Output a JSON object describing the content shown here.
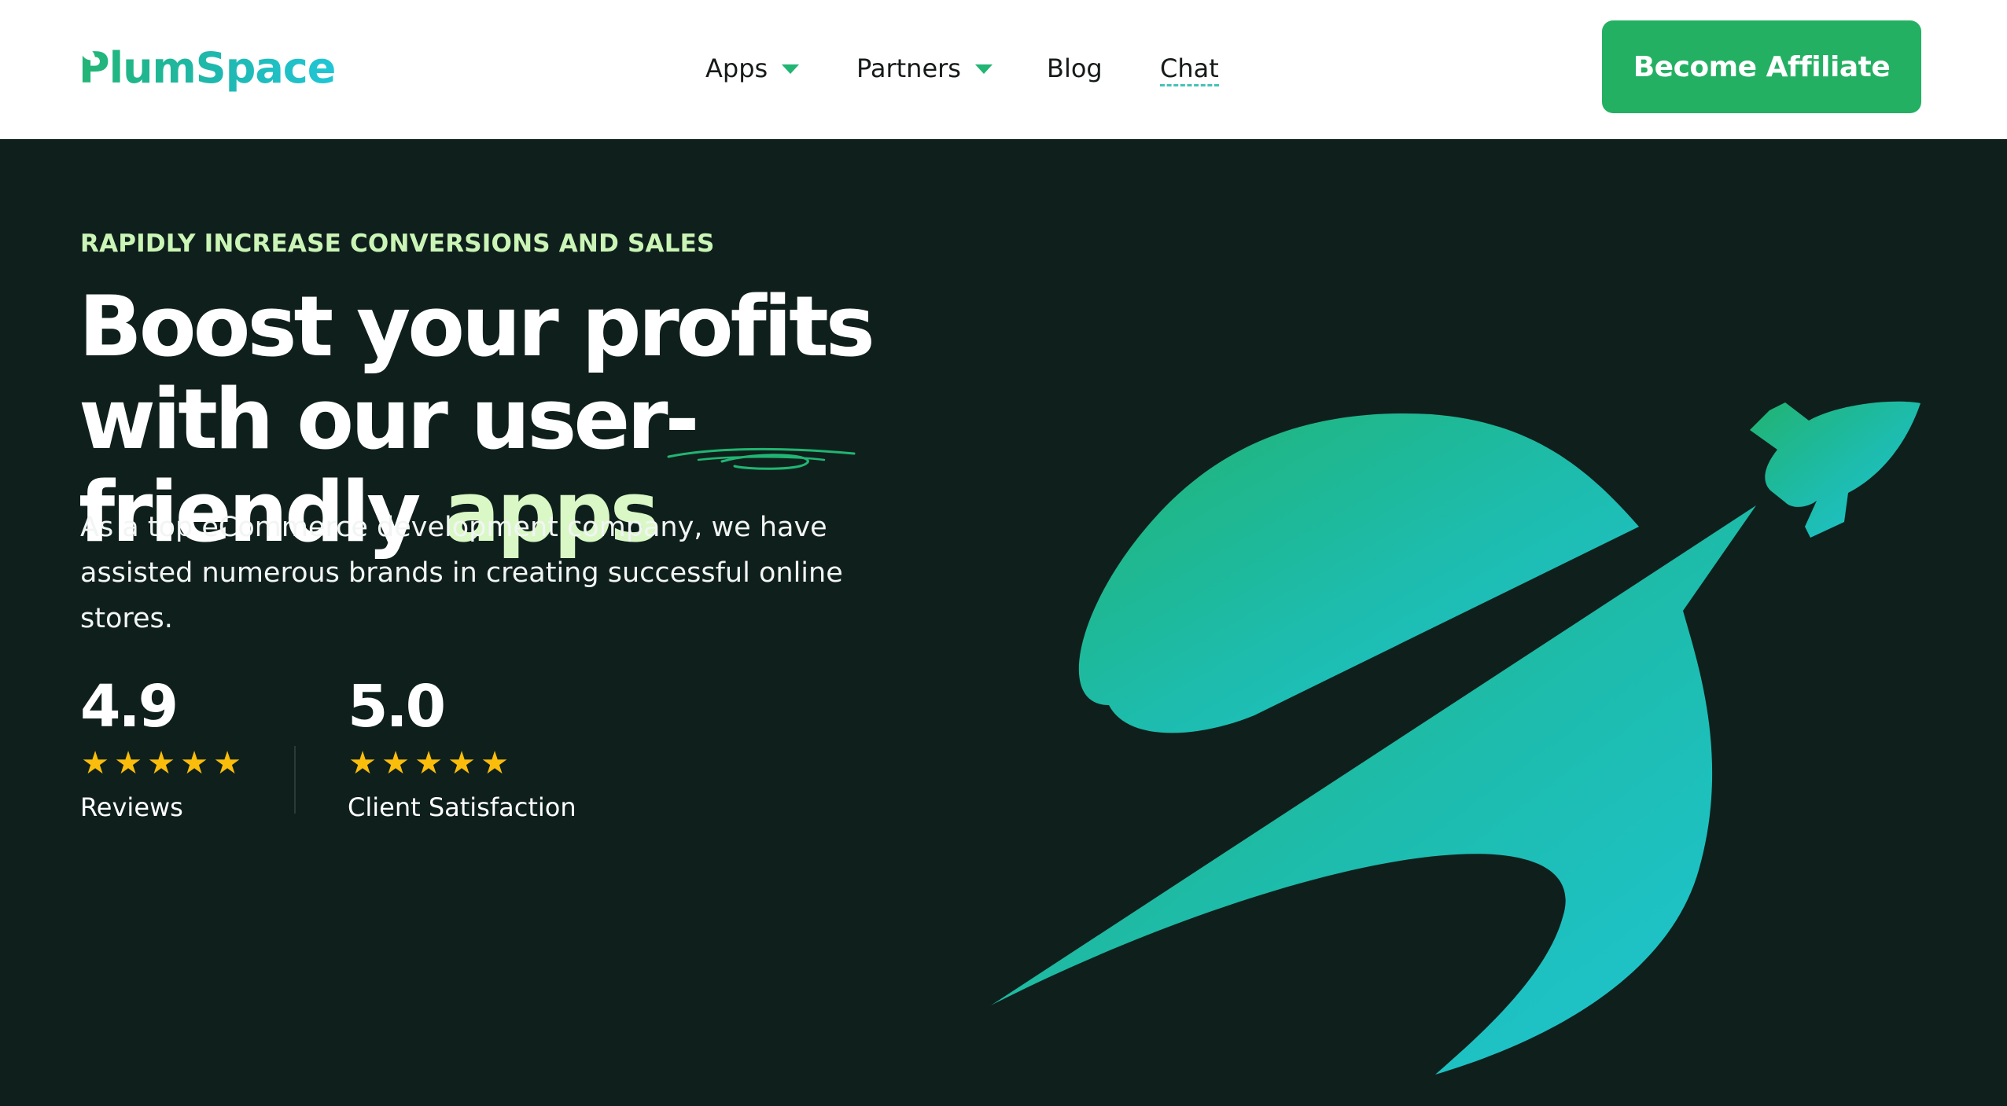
{
  "header": {
    "logo_text": "PlumSpace",
    "nav": [
      {
        "label": "Apps",
        "has_dropdown": true
      },
      {
        "label": "Partners",
        "has_dropdown": true
      },
      {
        "label": "Blog",
        "has_dropdown": false
      },
      {
        "label": "Chat",
        "has_dropdown": false
      }
    ],
    "cta_label": "Become Affiliate"
  },
  "hero": {
    "eyebrow": "RAPIDLY INCREASE CONVERSIONS AND SALES",
    "headline_main": "Boost your profits with our user-friendly ",
    "headline_accent": "apps",
    "description": "As a top eCommerce development company, we have assisted numerous brands in creating successful online stores.",
    "stats": [
      {
        "value": "4.9",
        "stars": 5,
        "label": "Reviews"
      },
      {
        "value": "5.0",
        "stars": 5,
        "label": "Client Satisfaction"
      }
    ],
    "illustration": "rocket-planet-icon"
  },
  "colors": {
    "brand_green": "#24b062",
    "brand_teal": "#20c6d6",
    "hero_bg": "#0f201c",
    "accent_light_green": "#d9f8c6",
    "star_yellow": "#fbbd0b",
    "header_bg": "#ffffff"
  }
}
